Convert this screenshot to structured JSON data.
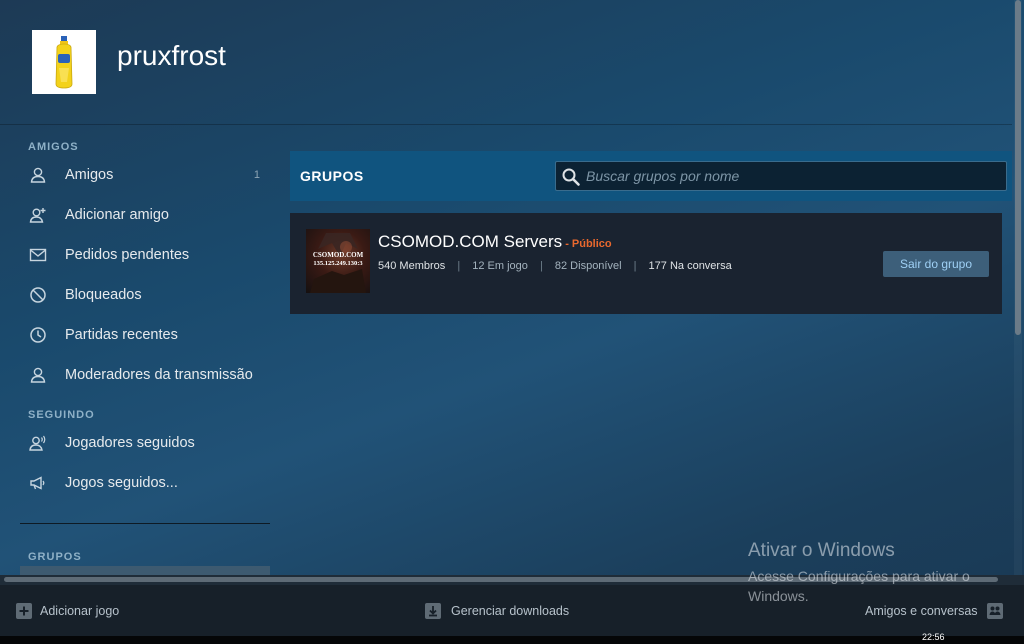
{
  "profile": {
    "username": "pruxfrost"
  },
  "sidebar": {
    "friends_section": "AMIGOS",
    "friends_items": [
      {
        "label": "Amigos",
        "count": "1",
        "icon": "person-icon"
      },
      {
        "label": "Adicionar amigo",
        "icon": "person-add-icon"
      },
      {
        "label": "Pedidos pendentes",
        "icon": "envelope-icon"
      },
      {
        "label": "Bloqueados",
        "icon": "blocked-icon"
      },
      {
        "label": "Partidas recentes",
        "icon": "clock-icon"
      },
      {
        "label": "Moderadores da transmissão",
        "icon": "person-icon"
      }
    ],
    "following_section": "SEGUINDO",
    "following_items": [
      {
        "label": "Jogadores seguidos",
        "icon": "person-broadcast-icon"
      },
      {
        "label": "Jogos seguidos...",
        "icon": "megaphone-icon"
      }
    ],
    "groups_section": "GRUPOS"
  },
  "groups": {
    "title": "GRUPOS",
    "search_placeholder": "Buscar grupos por nome",
    "items": [
      {
        "name": "CSOMOD.COM Servers",
        "visibility": "- Público",
        "thumb_line1": "CSOMOD.COM",
        "thumb_line2": "135.125.249.130:3",
        "members_count": "540",
        "members_label": "Membros",
        "in_game": "12 Em jogo",
        "online": "82 Disponível",
        "chat_count": "177",
        "chat_label": "Na conversa",
        "leave_label": "Sair do grupo"
      }
    ]
  },
  "bottom_bar": {
    "add_game": "Adicionar jogo",
    "downloads": "Gerenciar downloads",
    "friends_chat": "Amigos e conversas"
  },
  "watermark": {
    "title": "Ativar o Windows",
    "subtitle": "Acesse Configurações para ativar o Windows."
  },
  "taskbar": {
    "time": "22:56"
  },
  "colors": {
    "accent_header": "#10547f",
    "public_label": "#e8682e",
    "button_bg": "#3d5f7a",
    "button_text": "#9fd0f5"
  }
}
